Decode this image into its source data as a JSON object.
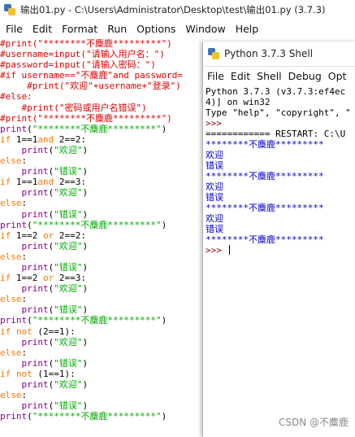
{
  "editor": {
    "title": "输出01.py - C:\\Users\\Administrator\\Desktop\\test\\输出01.py (3.7.3)",
    "menu": [
      "File",
      "Edit",
      "Format",
      "Run",
      "Options",
      "Window",
      "Help"
    ],
    "code_lines": [
      [
        {
          "t": "#print(\"********不麋鹿*********\")",
          "c": "comment"
        }
      ],
      [
        {
          "t": "#username=input(\"请输入用户名：\")",
          "c": "comment"
        }
      ],
      [
        {
          "t": "#password=input(\"请输入密码：\")",
          "c": "comment"
        }
      ],
      [
        {
          "t": "#if username==\"不麋鹿\"and password=",
          "c": "comment"
        }
      ],
      [
        {
          "t": "     #print(\"欢迎\"+username+\"登录\")",
          "c": "comment"
        }
      ],
      [
        {
          "t": "#else:",
          "c": "comment"
        }
      ],
      [
        {
          "t": "    #print(\"密码或用户名错误\")",
          "c": "comment"
        }
      ],
      [
        {
          "t": "#print(\"********不麋鹿*********\")",
          "c": "comment"
        }
      ],
      [
        {
          "t": "print",
          "c": "builtin"
        },
        {
          "t": "(",
          "c": "plain"
        },
        {
          "t": "\"********不麋鹿*********\"",
          "c": "string"
        },
        {
          "t": ")",
          "c": "plain"
        }
      ],
      [
        {
          "t": "if",
          "c": "keyword"
        },
        {
          "t": " 1==1",
          "c": "plain"
        },
        {
          "t": "and",
          "c": "keyword"
        },
        {
          "t": " 2==2:",
          "c": "plain"
        }
      ],
      [
        {
          "t": "    ",
          "c": "plain"
        },
        {
          "t": "print",
          "c": "builtin"
        },
        {
          "t": "(",
          "c": "plain"
        },
        {
          "t": "\"欢迎\"",
          "c": "string"
        },
        {
          "t": ")",
          "c": "plain"
        }
      ],
      [
        {
          "t": "else",
          "c": "keyword"
        },
        {
          "t": ":",
          "c": "plain"
        }
      ],
      [
        {
          "t": "    ",
          "c": "plain"
        },
        {
          "t": "print",
          "c": "builtin"
        },
        {
          "t": "(",
          "c": "plain"
        },
        {
          "t": "\"错误\"",
          "c": "string"
        },
        {
          "t": ")",
          "c": "plain"
        }
      ],
      [
        {
          "t": "if",
          "c": "keyword"
        },
        {
          "t": " 1==1",
          "c": "plain"
        },
        {
          "t": "and",
          "c": "keyword"
        },
        {
          "t": " 2==3:",
          "c": "plain"
        }
      ],
      [
        {
          "t": "    ",
          "c": "plain"
        },
        {
          "t": "print",
          "c": "builtin"
        },
        {
          "t": "(",
          "c": "plain"
        },
        {
          "t": "\"欢迎\"",
          "c": "string"
        },
        {
          "t": ")",
          "c": "plain"
        }
      ],
      [
        {
          "t": "else",
          "c": "keyword"
        },
        {
          "t": ":",
          "c": "plain"
        }
      ],
      [
        {
          "t": "    ",
          "c": "plain"
        },
        {
          "t": "print",
          "c": "builtin"
        },
        {
          "t": "(",
          "c": "plain"
        },
        {
          "t": "\"错误\"",
          "c": "string"
        },
        {
          "t": ")",
          "c": "plain"
        }
      ],
      [
        {
          "t": "print",
          "c": "builtin"
        },
        {
          "t": "(",
          "c": "plain"
        },
        {
          "t": "\"********不麋鹿*********\"",
          "c": "string"
        },
        {
          "t": ")",
          "c": "plain"
        }
      ],
      [
        {
          "t": "if",
          "c": "keyword"
        },
        {
          "t": " 1==2 ",
          "c": "plain"
        },
        {
          "t": "or",
          "c": "keyword"
        },
        {
          "t": " 2==2:",
          "c": "plain"
        }
      ],
      [
        {
          "t": "    ",
          "c": "plain"
        },
        {
          "t": "print",
          "c": "builtin"
        },
        {
          "t": "(",
          "c": "plain"
        },
        {
          "t": "\"欢迎\"",
          "c": "string"
        },
        {
          "t": ")",
          "c": "plain"
        }
      ],
      [
        {
          "t": "else",
          "c": "keyword"
        },
        {
          "t": ":",
          "c": "plain"
        }
      ],
      [
        {
          "t": "    ",
          "c": "plain"
        },
        {
          "t": "print",
          "c": "builtin"
        },
        {
          "t": "(",
          "c": "plain"
        },
        {
          "t": "\"错误\"",
          "c": "string"
        },
        {
          "t": ")",
          "c": "plain"
        }
      ],
      [
        {
          "t": "if",
          "c": "keyword"
        },
        {
          "t": " 1==2 ",
          "c": "plain"
        },
        {
          "t": "or",
          "c": "keyword"
        },
        {
          "t": " 2==3:",
          "c": "plain"
        }
      ],
      [
        {
          "t": "    ",
          "c": "plain"
        },
        {
          "t": "print",
          "c": "builtin"
        },
        {
          "t": "(",
          "c": "plain"
        },
        {
          "t": "\"欢迎\"",
          "c": "string"
        },
        {
          "t": ")",
          "c": "plain"
        }
      ],
      [
        {
          "t": "else",
          "c": "keyword"
        },
        {
          "t": ":",
          "c": "plain"
        }
      ],
      [
        {
          "t": "    ",
          "c": "plain"
        },
        {
          "t": "print",
          "c": "builtin"
        },
        {
          "t": "(",
          "c": "plain"
        },
        {
          "t": "\"错误\"",
          "c": "string"
        },
        {
          "t": ")",
          "c": "plain"
        }
      ],
      [
        {
          "t": "print",
          "c": "builtin"
        },
        {
          "t": "(",
          "c": "plain"
        },
        {
          "t": "\"********不麋鹿*********\"",
          "c": "string"
        },
        {
          "t": ")",
          "c": "plain"
        }
      ],
      [
        {
          "t": "if",
          "c": "keyword"
        },
        {
          "t": " ",
          "c": "plain"
        },
        {
          "t": "not",
          "c": "keyword"
        },
        {
          "t": " (2==1):",
          "c": "plain"
        }
      ],
      [
        {
          "t": "    ",
          "c": "plain"
        },
        {
          "t": "print",
          "c": "builtin"
        },
        {
          "t": "(",
          "c": "plain"
        },
        {
          "t": "\"欢迎\"",
          "c": "string"
        },
        {
          "t": ")",
          "c": "plain"
        }
      ],
      [
        {
          "t": "else",
          "c": "keyword"
        },
        {
          "t": ":",
          "c": "plain"
        }
      ],
      [
        {
          "t": "    ",
          "c": "plain"
        },
        {
          "t": "print",
          "c": "builtin"
        },
        {
          "t": "(",
          "c": "plain"
        },
        {
          "t": "\"错误\"",
          "c": "string"
        },
        {
          "t": ")",
          "c": "plain"
        }
      ],
      [
        {
          "t": "if",
          "c": "keyword"
        },
        {
          "t": " ",
          "c": "plain"
        },
        {
          "t": "not",
          "c": "keyword"
        },
        {
          "t": " (1==1):",
          "c": "plain"
        }
      ],
      [
        {
          "t": "    ",
          "c": "plain"
        },
        {
          "t": "print",
          "c": "builtin"
        },
        {
          "t": "(",
          "c": "plain"
        },
        {
          "t": "\"欢迎\"",
          "c": "string"
        },
        {
          "t": ")",
          "c": "plain"
        }
      ],
      [
        {
          "t": "else",
          "c": "keyword"
        },
        {
          "t": ":",
          "c": "plain"
        }
      ],
      [
        {
          "t": "    ",
          "c": "plain"
        },
        {
          "t": "print",
          "c": "builtin"
        },
        {
          "t": "(",
          "c": "plain"
        },
        {
          "t": "\"错误\"",
          "c": "string"
        },
        {
          "t": ")",
          "c": "plain"
        }
      ],
      [
        {
          "t": "print",
          "c": "builtin"
        },
        {
          "t": "(",
          "c": "plain"
        },
        {
          "t": "\"********不麋鹿*********\"",
          "c": "string"
        },
        {
          "t": ")",
          "c": "plain"
        }
      ]
    ]
  },
  "shell": {
    "title": "Python 3.7.3 Shell",
    "menu": [
      "File",
      "Edit",
      "Shell",
      "Debug",
      "Opt"
    ],
    "lines": [
      {
        "t": "Python 3.7.3 (v3.7.3:ef4ec",
        "c": "plain"
      },
      {
        "t": "4)] on win32",
        "c": "plain"
      },
      {
        "t": "Type \"help\", \"copyright\", \"",
        "c": "plain"
      },
      {
        "t": ">>>",
        "c": "prompt"
      },
      {
        "t": "============ RESTART: C:\\U",
        "c": "plain"
      },
      {
        "t": "********不麋鹿*********",
        "c": "out"
      },
      {
        "t": "欢迎",
        "c": "out"
      },
      {
        "t": "错误",
        "c": "out"
      },
      {
        "t": "********不麋鹿*********",
        "c": "out"
      },
      {
        "t": "欢迎",
        "c": "out"
      },
      {
        "t": "错误",
        "c": "out"
      },
      {
        "t": "********不麋鹿*********",
        "c": "out"
      },
      {
        "t": "欢迎",
        "c": "out"
      },
      {
        "t": "错误",
        "c": "out"
      },
      {
        "t": "********不麋鹿*********",
        "c": "out"
      },
      {
        "t": ">>> ",
        "c": "prompt"
      }
    ]
  },
  "watermark": "CSDN @不麋鹿"
}
